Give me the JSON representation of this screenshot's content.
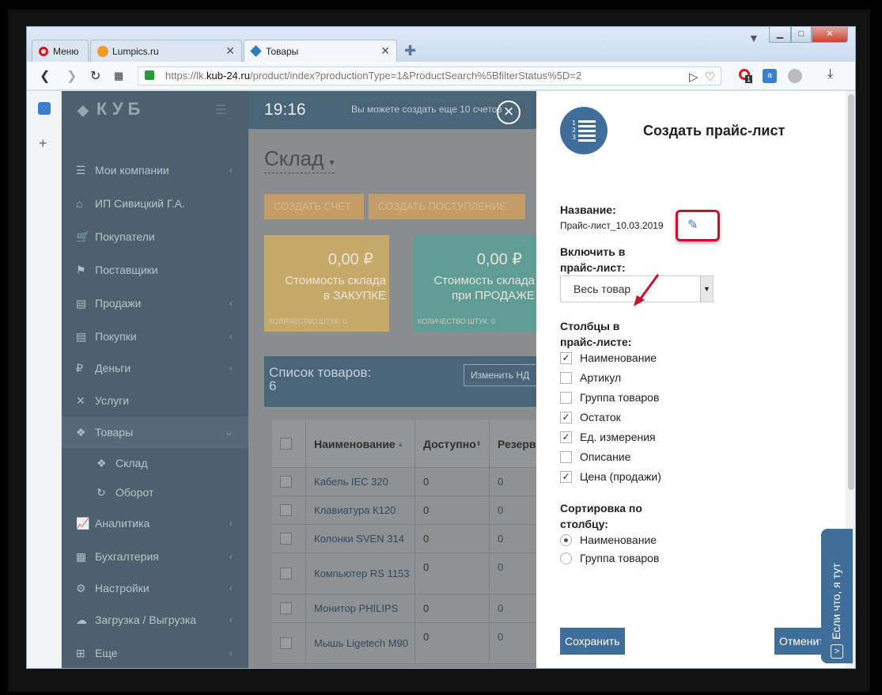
{
  "browser": {
    "tabs": [
      {
        "label": "Меню"
      },
      {
        "label": "Lumpics.ru"
      },
      {
        "label": "Товары"
      }
    ],
    "url_prefix": "https://lk.",
    "url_host": "kub-24.ru",
    "url_path": "/product/index?productionType=1&ProductSearch%5BfilterStatus%5D=2",
    "ext_badge": "1"
  },
  "app": {
    "logo": "КУБ",
    "time": "19:16",
    "notice": "Вы можете создать еще 10 счетов",
    "nav": [
      {
        "label": "Мои компании",
        "icon": "list-icon",
        "glyph": "☰"
      },
      {
        "label": "ИП Сивицкий Г.А.",
        "icon": "home-icon",
        "glyph": "⌂"
      },
      {
        "label": "Покупатели",
        "icon": "cart-icon",
        "glyph": "🛒"
      },
      {
        "label": "Поставщики",
        "icon": "supplier-icon",
        "glyph": "⚑"
      },
      {
        "label": "Продажи",
        "icon": "document-icon",
        "glyph": "▤"
      },
      {
        "label": "Покупки",
        "icon": "document-icon",
        "glyph": "▤"
      },
      {
        "label": "Деньги",
        "icon": "ruble-icon",
        "glyph": "₽"
      },
      {
        "label": "Услуги",
        "icon": "tools-icon",
        "glyph": "✕"
      },
      {
        "label": "Товары",
        "icon": "cubes-icon",
        "glyph": "❖"
      },
      {
        "label": "Склад",
        "icon": "cubes-icon",
        "glyph": "❖"
      },
      {
        "label": "Оборот",
        "icon": "refresh-icon",
        "glyph": "↻"
      },
      {
        "label": "Аналитика",
        "icon": "chart-icon",
        "glyph": "📈"
      },
      {
        "label": "Бухгалтерия",
        "icon": "calculator-icon",
        "glyph": "▦"
      },
      {
        "label": "Настройки",
        "icon": "gear-icon",
        "glyph": "⚙"
      },
      {
        "label": "Загрузка / Выгрузка",
        "icon": "cloud-icon",
        "glyph": "☁"
      },
      {
        "label": "Еще",
        "icon": "plus-box-icon",
        "glyph": "⊞"
      }
    ]
  },
  "main": {
    "heading": "Склад",
    "btn_invoice": "СОЗДАТЬ СЧЕТ",
    "btn_receipt": "СОЗДАТЬ ПОСТУПЛЕНИЕ",
    "card1": {
      "value": "0,00 ₽",
      "label1": "Стоимость склада",
      "label2": "в ЗАКУПКЕ",
      "count": "КОЛИЧЕСТВО ШТУК: 0",
      "color": "#c7a96a"
    },
    "card2": {
      "value": "0,00 ₽",
      "label1": "Стоимость склада",
      "label2": "при ПРОДАЖЕ",
      "count": "КОЛИЧЕСТВО ШТУК: 0",
      "color": "#5f9c95"
    },
    "list_title": "Список товаров:",
    "list_count": "6",
    "edit_nds": "Изменить НД",
    "columns": [
      "Наименование",
      "Доступно",
      "Резерв"
    ],
    "rows": [
      {
        "name": "Кабель IEC 320",
        "avail": "0",
        "res": "0"
      },
      {
        "name": "Клавиатура К120",
        "avail": "0",
        "res": "0"
      },
      {
        "name": "Колонки SVEN 314",
        "avail": "0",
        "res": "0"
      },
      {
        "name": "Компьютер RS 1153",
        "avail": "0",
        "res": "0"
      },
      {
        "name": "Монитор PHILIPS",
        "avail": "0",
        "res": "0"
      },
      {
        "name": "Мышь Ligetech M90",
        "avail": "0",
        "res": "0"
      }
    ]
  },
  "modal": {
    "title": "Создать прайс-лист",
    "name_label": "Название:",
    "name_value": "Прайс-лист_10.03.2019",
    "include_label1": "Включить в",
    "include_label2": "прайс-лист:",
    "include_value": "Весь товар",
    "columns_label1": "Столбцы в",
    "columns_label2": "прайс-листе:",
    "columns": [
      {
        "label": "Наименование",
        "checked": true
      },
      {
        "label": "Артикул",
        "checked": false
      },
      {
        "label": "Группа товаров",
        "checked": false
      },
      {
        "label": "Остаток",
        "checked": true
      },
      {
        "label": "Ед. измерения",
        "checked": true
      },
      {
        "label": "Описание",
        "checked": false
      },
      {
        "label": "Цена (продажи)",
        "checked": true
      }
    ],
    "sort_label1": "Сортировка по",
    "sort_label2": "столбцу:",
    "sort_options": [
      {
        "label": "Наименование",
        "selected": true
      },
      {
        "label": "Группа товаров",
        "selected": false
      }
    ],
    "save": "Сохранить",
    "cancel": "Отменить"
  },
  "feedback": {
    "label": "Если что, я тут",
    "btn": ">"
  }
}
